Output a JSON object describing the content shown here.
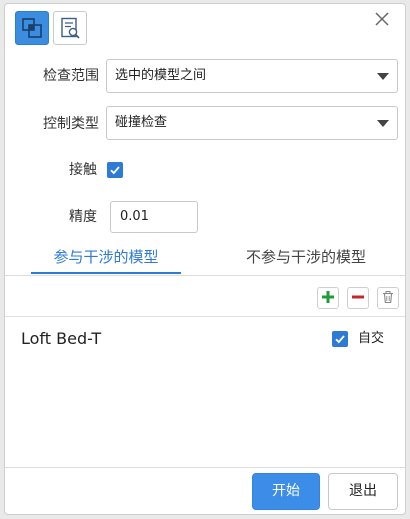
{
  "toolbar": {
    "icons": [
      "model-interference-icon",
      "inspection-report-icon"
    ]
  },
  "form": {
    "scope_label": "检查范围",
    "scope_value": "选中的模型之间",
    "control_label": "控制类型",
    "control_value": "碰撞检查",
    "contact_label": "接触",
    "contact_checked": true,
    "precision_label": "精度",
    "precision_value": "0.01"
  },
  "tabs": [
    {
      "label": "参与干涉的模型",
      "active": true
    },
    {
      "label": "不参与干涉的模型",
      "active": false
    }
  ],
  "list_tools": [
    "add-icon",
    "remove-icon",
    "trash-icon"
  ],
  "models": [
    {
      "name": "Loft Bed-T",
      "self_intersect_label": "自交",
      "self_intersect_checked": true
    }
  ],
  "footer": {
    "start_label": "开始",
    "exit_label": "退出"
  },
  "colors": {
    "accent": "#2e7bd6",
    "primary_button": "#3b8de8",
    "add_green": "#1f9b3a",
    "remove_red": "#c62828"
  }
}
